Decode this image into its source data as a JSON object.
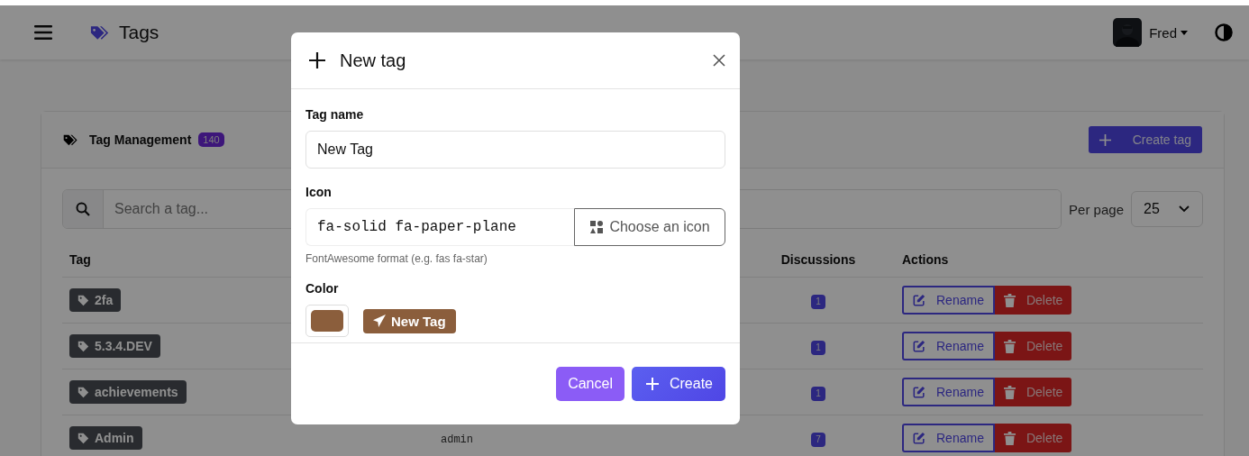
{
  "header": {
    "title": "Tags",
    "user": "Fred"
  },
  "card": {
    "title": "Tag Management",
    "count": "140",
    "create_button": "Create tag"
  },
  "search": {
    "placeholder": "Search a tag..."
  },
  "per_page": {
    "label": "Per page",
    "value": "25"
  },
  "table": {
    "columns": [
      {
        "label": "Tag",
        "kind": "tag"
      },
      {
        "label": "Discussions",
        "kind": "count"
      },
      {
        "label": "Actions",
        "kind": "actions"
      }
    ],
    "rows": [
      {
        "tag": "2fa",
        "discussions": "1",
        "rename": "Rename",
        "delete": "Delete"
      },
      {
        "tag": "5.3.4.DEV",
        "discussions": "1",
        "rename": "Rename",
        "delete": "Delete"
      },
      {
        "tag": "achievements",
        "discussions": "1",
        "rename": "Rename",
        "delete": "Delete"
      },
      {
        "tag": "Admin",
        "column_2": "admin",
        "discussions": "7",
        "rename": "Rename",
        "delete": "Delete"
      }
    ]
  },
  "modal": {
    "title": "New tag",
    "name": {
      "label": "Tag name",
      "value": "New Tag"
    },
    "icon": {
      "label": "Icon",
      "value": "fa-solid fa-paper-plane",
      "button": "Choose an icon",
      "help": "FontAwesome format (e.g. fas fa-star)"
    },
    "color_field": {
      "label": "Color",
      "color": "#8b5e3c",
      "preview": "New Tag"
    },
    "buttons": [
      {
        "label": "Cancel",
        "kind": "secondary"
      },
      {
        "label": "Create",
        "kind": "primary"
      }
    ]
  }
}
